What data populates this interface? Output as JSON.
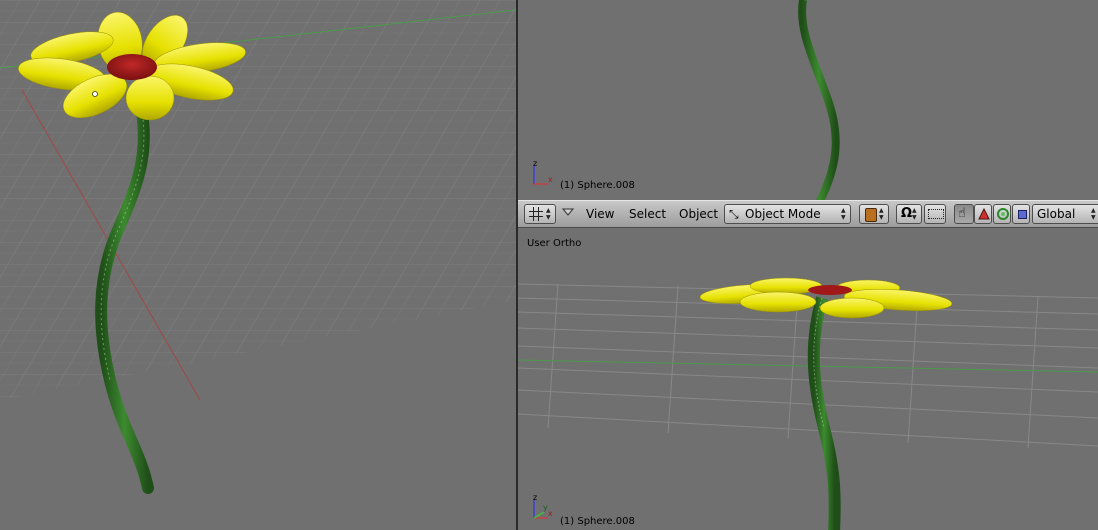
{
  "viewports": {
    "top_right": {
      "object_label": "(1) Sphere.008"
    },
    "bottom_right": {
      "view_name": "User Ortho",
      "object_label": "(1) Sphere.008"
    }
  },
  "header": {
    "menus": {
      "view": "View",
      "select": "Select",
      "object": "Object"
    },
    "mode": "Object Mode",
    "orientation": "Global"
  },
  "axes": {
    "x": "x",
    "y": "y",
    "z": "z"
  },
  "colors": {
    "petal": "#e6e100",
    "center": "#a01818",
    "stem": "#2f6e24",
    "grid": "#888888",
    "x_axis": "#c84040",
    "y_axis": "#40c040",
    "z_axis": "#4040d0"
  }
}
